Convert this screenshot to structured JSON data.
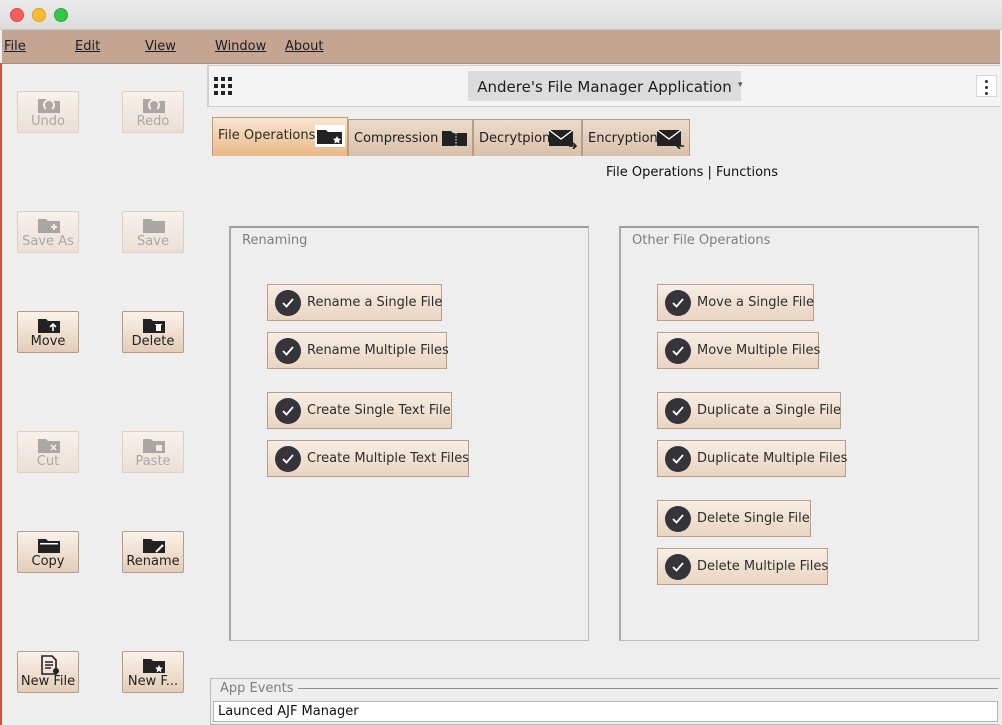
{
  "window": {
    "controls": [
      "close",
      "minimize",
      "zoom"
    ]
  },
  "menubar": {
    "items": [
      "File",
      "Edit",
      "View",
      "Window",
      "About"
    ]
  },
  "sidebar": {
    "buttons": [
      {
        "label": "Undo",
        "icon": "undo-folder-icon",
        "enabled": false
      },
      {
        "label": "Redo",
        "icon": "redo-folder-icon",
        "enabled": false
      },
      {
        "label": "Save As",
        "icon": "save-as-folder-icon",
        "enabled": false
      },
      {
        "label": "Save",
        "icon": "save-folder-icon",
        "enabled": false
      },
      {
        "label": "Move",
        "icon": "move-folder-icon",
        "enabled": true
      },
      {
        "label": "Delete",
        "icon": "delete-folder-icon",
        "enabled": true
      },
      {
        "label": "Cut",
        "icon": "cut-folder-icon",
        "enabled": false
      },
      {
        "label": "Paste",
        "icon": "paste-folder-icon",
        "enabled": false
      },
      {
        "label": "Copy",
        "icon": "copy-folder-icon",
        "enabled": true
      },
      {
        "label": "Rename",
        "icon": "rename-folder-icon",
        "enabled": true
      },
      {
        "label": "New File",
        "icon": "new-file-icon",
        "enabled": true
      },
      {
        "label": "New F...",
        "icon": "new-folder-icon",
        "enabled": true
      }
    ]
  },
  "header": {
    "title": "Andere's File Manager Application",
    "menu_icon": "grid-menu-icon",
    "overflow_icon": "kebab-menu-icon"
  },
  "tabs": [
    {
      "label": "File Operations",
      "icon": "folder-star-icon",
      "active": true
    },
    {
      "label": "Compression",
      "icon": "zip-folder-icon",
      "active": false
    },
    {
      "label": "Decrytpion",
      "icon": "envelope-out-icon",
      "active": false
    },
    {
      "label": "Encryption",
      "icon": "envelope-in-icon",
      "active": false
    }
  ],
  "tab_subtitle": "File Operations | Functions",
  "groups": {
    "renaming": {
      "title": "Renaming",
      "buttons": [
        "Rename a Single File",
        "Rename Multiple Files",
        "Create Single Text File",
        "Create Multiple Text Files"
      ]
    },
    "other": {
      "title": "Other File Operations",
      "buttons": [
        "Move a Single File",
        "Move Multiple Files",
        "Duplicate a Single File",
        "Duplicate Multiple Files",
        "Delete Single File",
        "Delete Multiple Files"
      ]
    }
  },
  "events": {
    "title": "App Events",
    "log": "Launced AJF Manager"
  },
  "colors": {
    "menubar": "#c4a592",
    "active_tab": "#e9b985",
    "check_circle": "#34343a",
    "close": "#fc5f57",
    "minimize": "#fdbc2e",
    "zoom": "#33c748"
  }
}
